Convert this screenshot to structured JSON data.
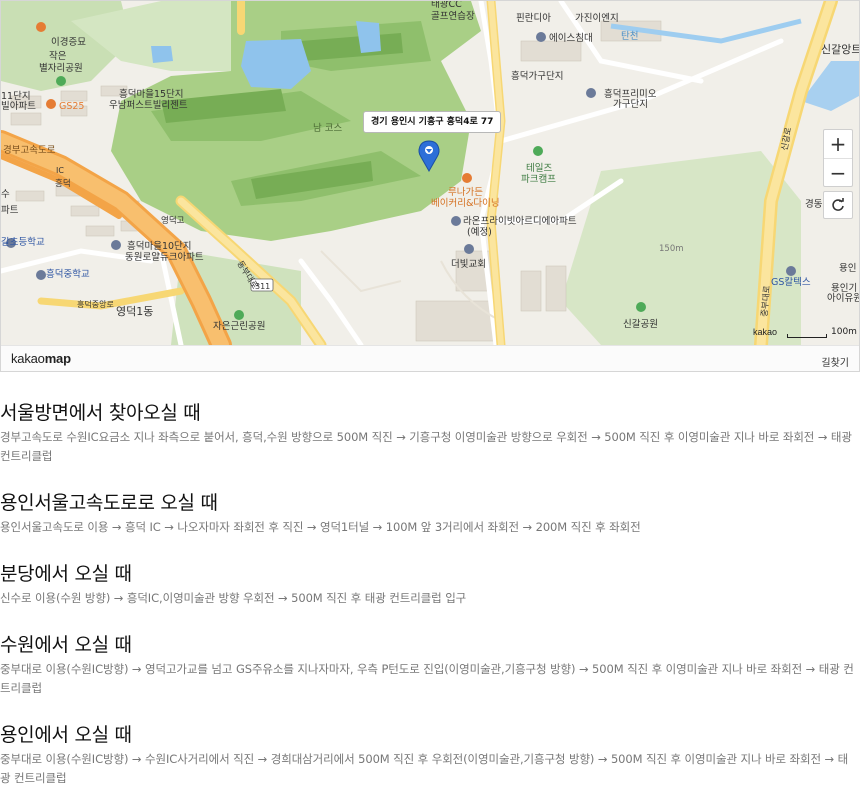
{
  "map": {
    "address_label": "경기 용인시 기흥구 흥덕4로 77",
    "labels": {
      "iseungjumyo": "이경증묘",
      "taekwangcc": "태광CC",
      "golf_range": "골프연습장",
      "pinrandia": "핀란디아",
      "gajin": "가진이엔지",
      "eseuchim": "에이스침대",
      "tancheon": "탄천",
      "singal_apt": "신갈앙트트",
      "heungdeok_gagu": "흥덕가구단지",
      "jageun_park": "작은",
      "byeoljari_park": "별자리공원",
      "danji11": "11단지",
      "billa": "빌아파트",
      "gs25": "GS25",
      "heungdeok15": "흥덕마을15단지",
      "uneum": "우남퍼스트빌리젠트",
      "heungdeok_primio": "흥덕프리미오",
      "gagu_danji": "가구단지",
      "course": "남 코스",
      "gyeongbu": "경부고속도로",
      "ic": "IC",
      "heungdeok": "흥덕",
      "telluride": "테일즈",
      "park_camp": "파크캠프",
      "lunagarden": "루나가든",
      "bakery": "베이커리&다이닝",
      "laon": "라온프라이빗아르디에아파트",
      "yejeong": "(예정)",
      "gyeongdong": "경동",
      "yeongdeok_road": "영덕고",
      "galcho": "갈초등학교",
      "heungdeok10": "흥덕마을10단지",
      "dongwon": "동원로얄듀크아파트",
      "dongbu_road": "동부대로",
      "heungdeok_mid": "흥덕중학교",
      "road311": "311",
      "deobit": "더빛교회",
      "m150": "150m",
      "gs_caltex": "GS칼텍스",
      "yongin_ai": "용인기",
      "aiyu": "아이유원",
      "yeongdeok1": "영덕1동",
      "heungdeok_jung": "흥덕중앙로",
      "jaeun_park": "자은근린공원",
      "singal_park": "신갈공원",
      "su": "수",
      "apt": "파트",
      "singalro": "신갈로",
      "jungbudaero": "중부대로",
      "yongin_right": "용인"
    },
    "scale_brand": "kakao",
    "scale_value": "100m",
    "zoom_in": "+",
    "zoom_out": "−",
    "footer": {
      "logo_light": "kakao",
      "logo_bold": "map",
      "route_link": "길찾기"
    }
  },
  "routes": [
    {
      "title": "서울방면에서 찾아오실 때",
      "description": "경부고속도로 수원IC요금소 지나 좌측으로 붙어서, 흥덕,수원 방향으로 500M 직진 → 기흥구청 이영미술관 방향으로 우회전 → 500M 직진 후 이영미술관 지나 바로 좌회전 → 태광 컨트리클럽"
    },
    {
      "title": "용인서울고속도로로 오실 때",
      "description": "용인서울고속도로 이용 → 흥덕 IC → 나오자마자 좌회전 후 직진 → 영덕1터널 → 100M 앞 3거리에서 좌회전 → 200M 직진 후 좌회전"
    },
    {
      "title": "분당에서 오실 때",
      "description": "신수로 이용(수원 방향) → 흥덕IC,이영미술관 방향 우회전 → 500M 직진 후 태광 컨트리클럽 입구"
    },
    {
      "title": "수원에서 오실 때",
      "description": "중부대로 이용(수원IC방향) → 영덕고가교를 넘고 GS주유소를 지나자마자, 우측 P턴도로 진입(이영미술관,기흥구청 방향) → 500M 직진 후 이영미술관 지나 바로 좌회전 → 태광 컨트리클럽"
    },
    {
      "title": "용인에서 오실 때",
      "description": "중부대로 이용(수원IC방향) → 수원IC사거리에서 직진 → 경희대삼거리에서 500M 직진 후 우회전(이영미술관,기흥구청 방향) → 500M 직진 후 이영미술관 지나 바로 좌회전 → 태광 컨트리클럽"
    }
  ]
}
